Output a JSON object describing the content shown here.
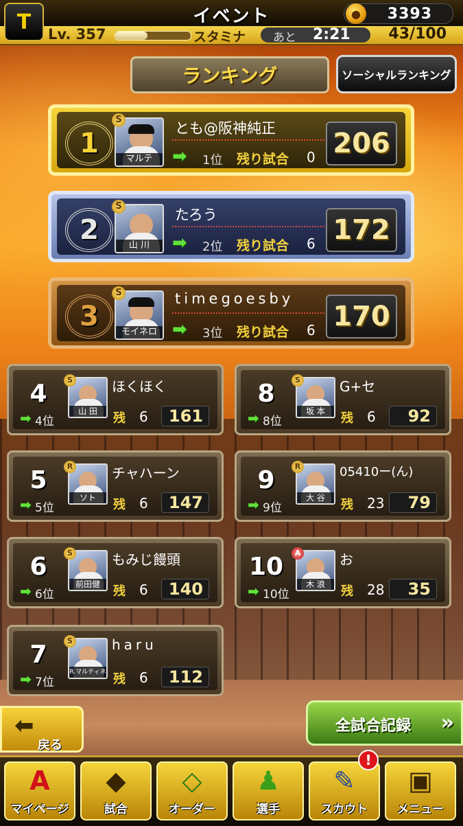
{
  "header": {
    "logo_text": "T",
    "title": "イベント",
    "coins": "3393",
    "level_label": "Lv.",
    "level": "357",
    "stamina_label": "スタミナ",
    "ato_label": "あと",
    "recovery_time": "2:21",
    "stamina_value": "43/100",
    "stamina_fill": 0.43
  },
  "tabs": {
    "ranking": "ランキング",
    "social": "ソーシャルランキング"
  },
  "labels": {
    "remaining_full": "残り試合",
    "remaining_short": "残"
  },
  "top3": [
    {
      "rank": "1",
      "name": "とも@阪神純正",
      "card": "マルテ",
      "badge": "S",
      "prev": "1位",
      "games": "0",
      "score": "206"
    },
    {
      "rank": "2",
      "name": "たろう",
      "card": "山 川",
      "badge": "S",
      "prev": "2位",
      "games": "6",
      "score": "172"
    },
    {
      "rank": "3",
      "name": "timegoesby",
      "card": "モイネロ",
      "badge": "S",
      "prev": "3位",
      "games": "6",
      "score": "170"
    }
  ],
  "others": [
    {
      "rank": "4",
      "name": "ほくほく",
      "card": "山 田",
      "badge": "S",
      "prev": "4位",
      "games": "6",
      "score": "161"
    },
    {
      "rank": "8",
      "name": "G+セ",
      "card": "坂 本",
      "badge": "S",
      "prev": "8位",
      "games": "6",
      "score": "92"
    },
    {
      "rank": "5",
      "name": "チャハーン",
      "card": "ソト",
      "badge": "R",
      "prev": "5位",
      "games": "6",
      "score": "147"
    },
    {
      "rank": "9",
      "name": "05410ー(ん)",
      "card": "大 谷",
      "badge": "R",
      "prev": "9位",
      "games": "23",
      "score": "79"
    },
    {
      "rank": "6",
      "name": "もみじ饅頭",
      "card": "前田健",
      "badge": "S",
      "prev": "6位",
      "games": "6",
      "score": "140"
    },
    {
      "rank": "10",
      "name": "お",
      "card": "木 浪",
      "badge": "A",
      "prev": "10位",
      "games": "28",
      "score": "35"
    },
    {
      "rank": "7",
      "name": "haru",
      "card": "R.マルティネス",
      "badge": "S",
      "prev": "7位",
      "games": "6",
      "score": "112"
    }
  ],
  "buttons": {
    "back": "戻る",
    "all_games": "全試合記録"
  },
  "nav": [
    {
      "label": "マイページ",
      "icon": "A"
    },
    {
      "label": "試合",
      "icon": "◆"
    },
    {
      "label": "オーダー",
      "icon": "◇"
    },
    {
      "label": "選手",
      "icon": "♟"
    },
    {
      "label": "スカウト",
      "icon": "✎"
    },
    {
      "label": "メニュー",
      "icon": "▣"
    }
  ],
  "notification": "!"
}
